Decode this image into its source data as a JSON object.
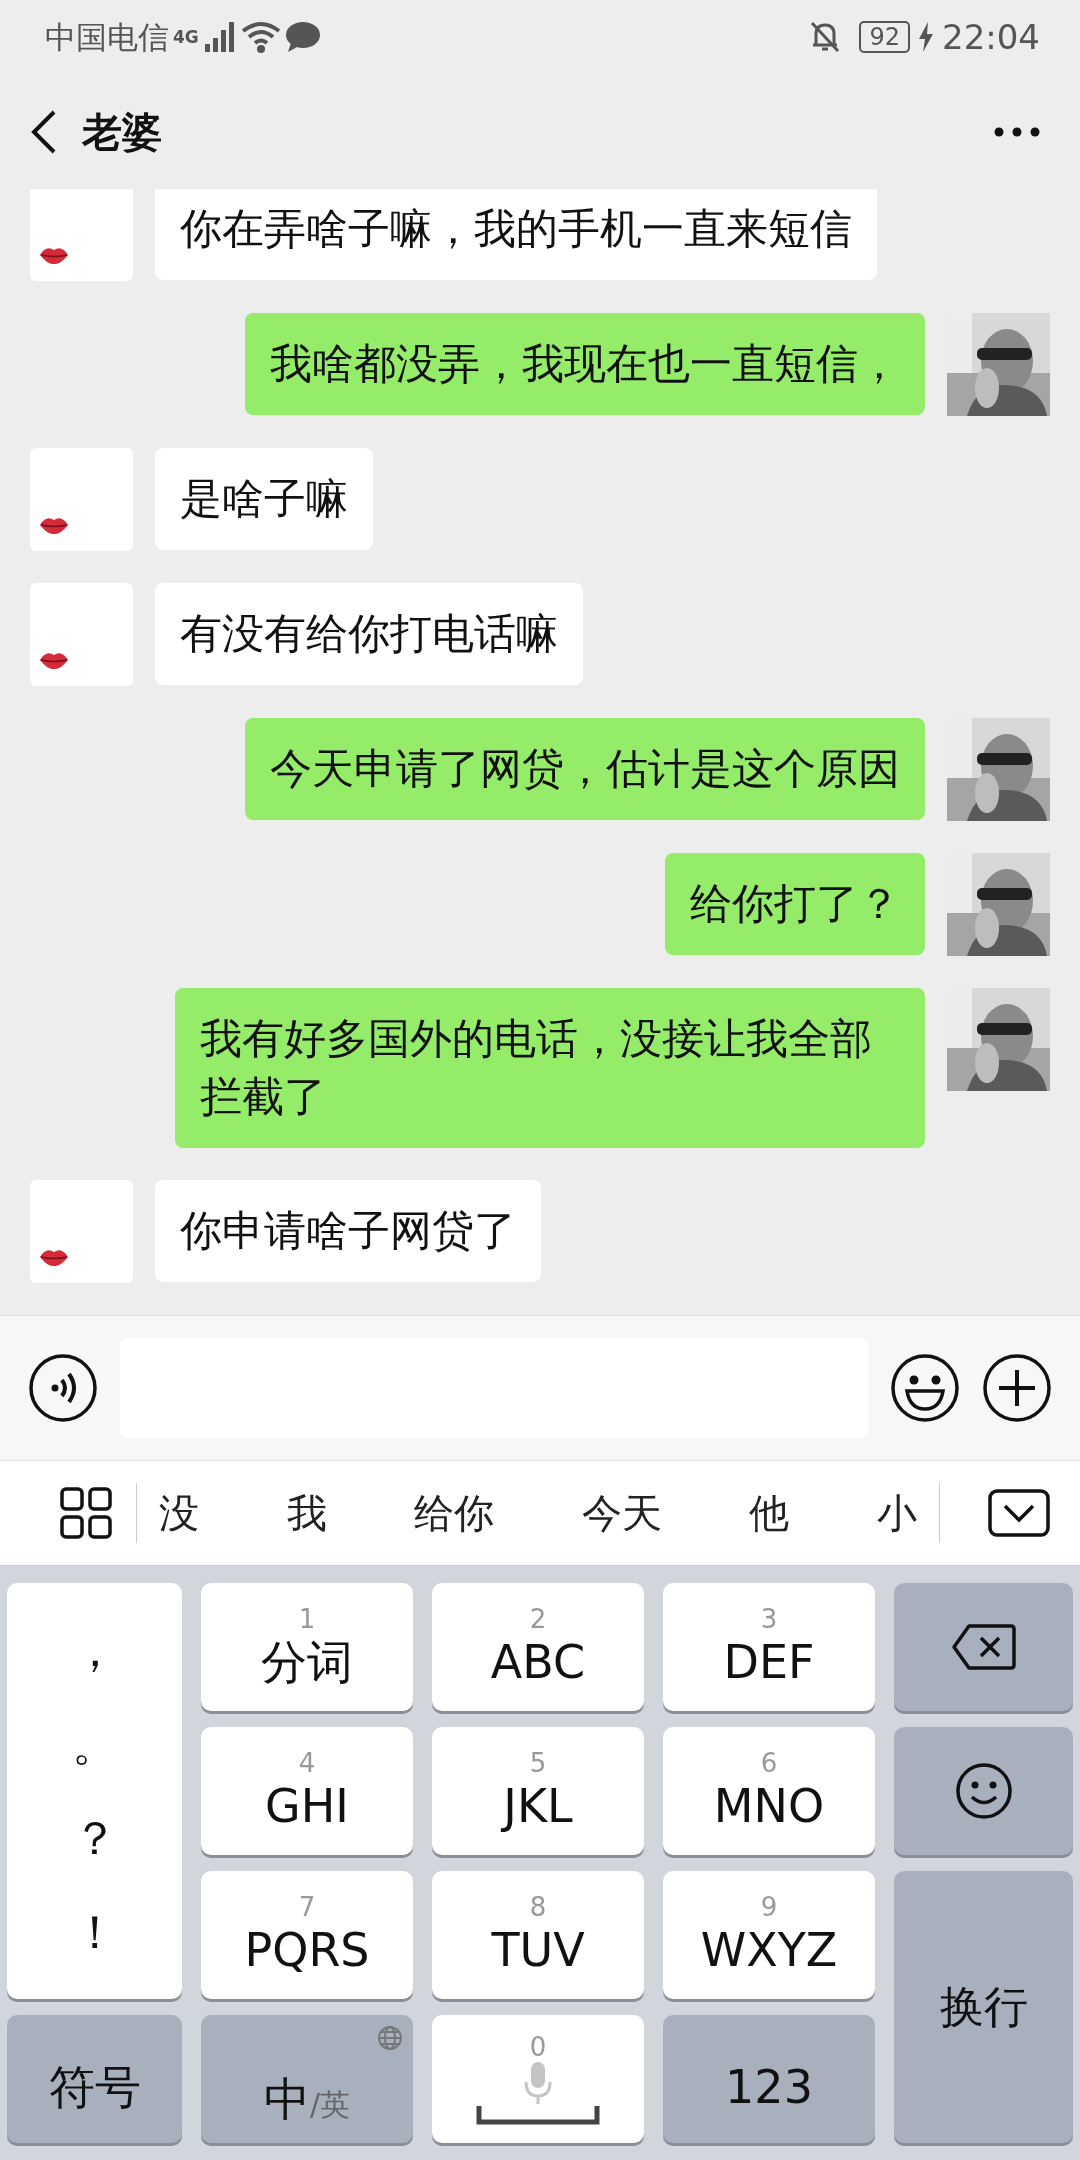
{
  "status_bar": {
    "carrier": "中国电信",
    "network": "4G",
    "battery": "92",
    "time": "22:04"
  },
  "header": {
    "title": "老婆"
  },
  "messages": [
    {
      "kind": "received",
      "text": "你在弄啥子嘛，我的手机一直来短信"
    },
    {
      "kind": "sent",
      "text": "我啥都没弄，我现在也一直短信，"
    },
    {
      "kind": "received",
      "text": "是啥子嘛"
    },
    {
      "kind": "received",
      "text": "有没有给你打电话嘛"
    },
    {
      "kind": "sent",
      "text": "今天申请了网贷，估计是这个原因"
    },
    {
      "kind": "sent",
      "text": "给你打了？"
    },
    {
      "kind": "sent",
      "text": "我有好多国外的电话，没接让我全部拦截了"
    },
    {
      "kind": "received",
      "text": "你申请啥子网贷了"
    }
  ],
  "candidates": [
    "没",
    "我",
    "给你",
    "今天",
    "他",
    "小"
  ],
  "keyboard": [
    {
      "kind": "punct",
      "chars": [
        "，",
        "。",
        "？",
        "！"
      ]
    },
    {
      "kind": "letter",
      "number": "1",
      "label": "分词"
    },
    {
      "kind": "letter",
      "number": "2",
      "label": "ABC"
    },
    {
      "kind": "letter",
      "number": "3",
      "label": "DEF"
    },
    {
      "kind": "delete"
    },
    {
      "kind": "letter",
      "number": "4",
      "label": "GHI"
    },
    {
      "kind": "letter",
      "number": "5",
      "label": "JKL"
    },
    {
      "kind": "letter",
      "number": "6",
      "label": "MNO"
    },
    {
      "kind": "emoji"
    },
    {
      "kind": "letter",
      "number": "7",
      "label": "PQRS"
    },
    {
      "kind": "letter",
      "number": "8",
      "label": "TUV"
    },
    {
      "kind": "letter",
      "number": "9",
      "label": "WXYZ"
    },
    {
      "kind": "enter",
      "label": "换行"
    },
    {
      "kind": "func",
      "label": "符号"
    },
    {
      "kind": "lang",
      "label": "中",
      "sub": "/英"
    },
    {
      "kind": "space",
      "number": "0"
    },
    {
      "kind": "func",
      "label": "123"
    }
  ]
}
